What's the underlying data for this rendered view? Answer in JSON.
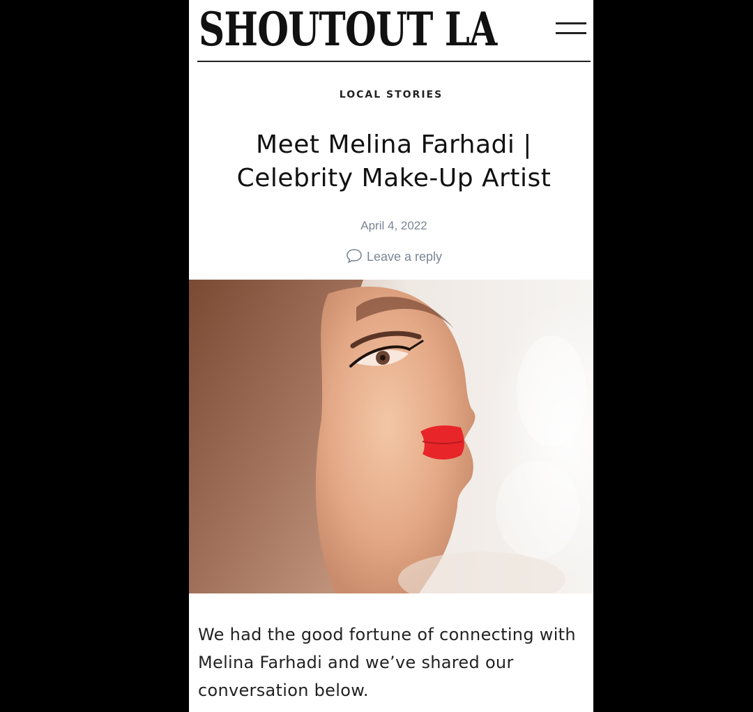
{
  "header": {
    "logo_text": "SHOUTOUT LA",
    "menu_icon": "hamburger-menu-icon"
  },
  "article": {
    "category": "LOCAL STORIES",
    "title": "Meet Melina Farhadi | Celebrity Make-Up Artist",
    "date": "April 4, 2022",
    "reply_label": "Leave a reply",
    "reply_icon": "comment-bubble-icon",
    "intro": "We had the good fortune of connecting with Melina Farhadi and we’ve shared our conversation below."
  },
  "colors": {
    "background": "#000000",
    "page": "#ffffff",
    "meta_text": "#7a8594",
    "lipstick_red": "#e8262a"
  }
}
